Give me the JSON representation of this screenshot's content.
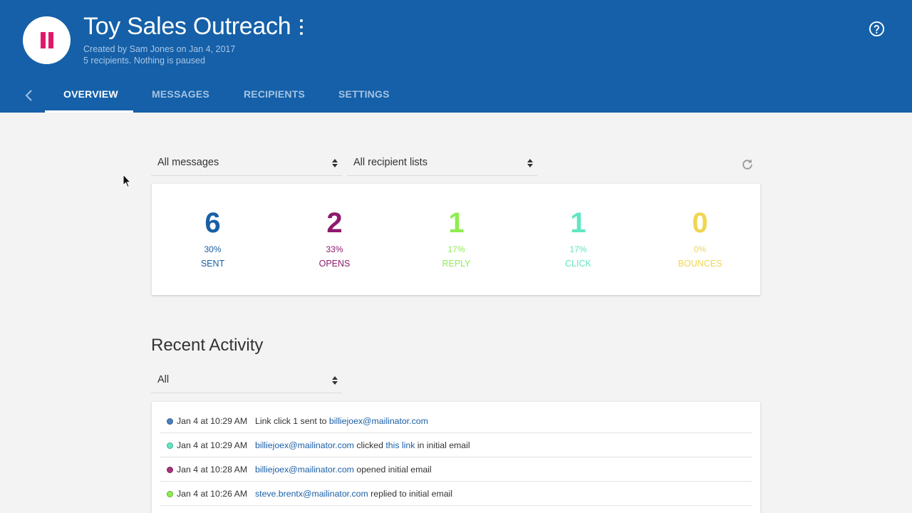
{
  "header": {
    "title": "Toy Sales Outreach",
    "subtitle_created": "Created by Sam Jones on Jan 4, 2017",
    "subtitle_status": "5 recipients. Nothing is paused"
  },
  "tabs": [
    {
      "label": "OVERVIEW",
      "active": true
    },
    {
      "label": "MESSAGES",
      "active": false
    },
    {
      "label": "RECIPIENTS",
      "active": false
    },
    {
      "label": "SETTINGS",
      "active": false
    }
  ],
  "filters": {
    "messages": "All messages",
    "recipients": "All recipient lists"
  },
  "stats": [
    {
      "value": "6",
      "percent": "30%",
      "label": "SENT",
      "color": "#1a5fa6"
    },
    {
      "value": "2",
      "percent": "33%",
      "label": "OPENS",
      "color": "#8e1a6e"
    },
    {
      "value": "1",
      "percent": "17%",
      "label": "REPLY",
      "color": "#8ded4e"
    },
    {
      "value": "1",
      "percent": "17%",
      "label": "CLICK",
      "color": "#5fe6c2"
    },
    {
      "value": "0",
      "percent": "0%",
      "label": "BOUNCES",
      "color": "#f0d650"
    }
  ],
  "activity": {
    "title": "Recent Activity",
    "filter": "All",
    "rows": [
      {
        "dot_color": "#4a7fbf",
        "time": "Jan 4 at 10:29 AM",
        "parts": [
          {
            "text": "Link click 1 sent to ",
            "link": false
          },
          {
            "text": "billiejoex@mailinator.com",
            "link": true
          }
        ]
      },
      {
        "dot_color": "#5fe6c2",
        "time": "Jan 4 at 10:29 AM",
        "parts": [
          {
            "text": "billiejoex@mailinator.com",
            "link": true
          },
          {
            "text": " clicked ",
            "link": false
          },
          {
            "text": "this link",
            "link": true
          },
          {
            "text": " in initial email",
            "link": false
          }
        ]
      },
      {
        "dot_color": "#a8327e",
        "time": "Jan 4 at 10:28 AM",
        "parts": [
          {
            "text": "billiejoex@mailinator.com",
            "link": true
          },
          {
            "text": " opened initial email",
            "link": false
          }
        ]
      },
      {
        "dot_color": "#8ded4e",
        "time": "Jan 4 at 10:26 AM",
        "parts": [
          {
            "text": "steve.brentx@mailinator.com",
            "link": true
          },
          {
            "text": " replied to initial email",
            "link": false
          }
        ]
      }
    ]
  }
}
